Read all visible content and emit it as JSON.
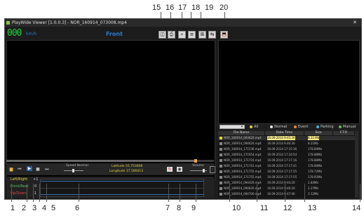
{
  "window": {
    "title": "PlayWide Viewer [1.0.0.3] - NOR_160914_073008.mp4",
    "speed_value": "000",
    "speed_unit": "km/h",
    "camera_label": "Front",
    "speed_slider_label": "Speed Normal",
    "latitude": "Latitude 55.753608",
    "longitude": "Longitude 37.580413",
    "volume_label": "Volume",
    "axis_labels": {
      "top": "+1",
      "mid": "0",
      "bottom": "-1"
    },
    "gsensor_legend": [
      "Left/Right",
      "Front/Rear",
      "Up/Down"
    ],
    "filter_dropdown": "All",
    "filters": [
      {
        "label": "All",
        "color": "#e2d43a"
      },
      {
        "label": "Normal",
        "color": "#e8e8e8"
      },
      {
        "label": "Event",
        "color": "#e88a2b"
      },
      {
        "label": "Parking",
        "color": "#38b6e0"
      },
      {
        "label": "Manual",
        "color": "#5fc05f"
      }
    ],
    "table_headers": [
      "File Name",
      "Date Time",
      "Size",
      "F.T.R"
    ],
    "rows": [
      {
        "name": "NOR_160914_093620.mp4",
        "date": "16.09.2014 9:45:30",
        "size": "8.22 Mb"
      },
      {
        "name": "NOR_160914_094620.mp4",
        "date": "16.09.2014 9:46:30",
        "size": "8.21Mb"
      },
      {
        "name": "NOR_160914_171536.mp4",
        "date": "16.09.2014 17:15:36",
        "size": "178.89Mb"
      },
      {
        "name": "NOR_160914_171654.mp4",
        "date": "16.09.2014 17:16:54",
        "size": "178.88Mb"
      },
      {
        "name": "NOR_160914_171716.mp4",
        "date": "16.09.2014 17:17:16",
        "size": "178.88Mb"
      },
      {
        "name": "NOR_160914_171741.mp4",
        "date": "16.09.2014 17:17:41",
        "size": "178.88Mb"
      },
      {
        "name": "NOR_160914_171755.mp4",
        "date": "16.09.2014 17:17:55",
        "size": "178.72Mb"
      },
      {
        "name": "NOR_160914_171755.mp4",
        "date": "16.09.2014 17:17:55",
        "size": "178.92Mb"
      },
      {
        "name": "NOR_160914_094420.mp4",
        "date": "16.09.2014 9:44:20",
        "size": "2.84Mb"
      },
      {
        "name": "NOR_160914_094620.mp4",
        "date": "16.09.2014 9:46:20",
        "size": "2.27Mb"
      },
      {
        "name": "NOR_160914_094700.mp4",
        "date": "16.09.2014 9:47:00",
        "size": "3.12Mb"
      }
    ]
  },
  "callouts_top": [
    "15",
    "16",
    "17",
    "18",
    "19",
    "20"
  ],
  "callouts_bottom": [
    "1",
    "2",
    "3",
    "4",
    "5",
    "6",
    "7",
    "8",
    "9",
    "10",
    "11",
    "12",
    "13",
    "14"
  ],
  "colors": {
    "speed_green": "#19d23b",
    "front_blue": "#2b7bd0",
    "highlight_row": "#f5e98a"
  }
}
